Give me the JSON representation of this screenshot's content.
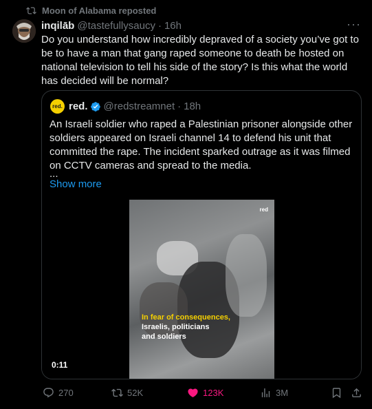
{
  "repost": {
    "text": "Moon of Alabama reposted"
  },
  "tweet": {
    "author_name": "inqilāb",
    "handle": "@tastefullysaucy",
    "separator": "·",
    "time": "16h",
    "more": "···",
    "text": "Do you understand how incredibly depraved of a society you’ve got to be to have a man that gang raped someone to death be hosted on national television to tell his side of the story? Is this what the world has decided will be normal?"
  },
  "quote": {
    "logo_text": "red.",
    "author_name": "red.",
    "handle": "@redstreamnet",
    "separator": "·",
    "time": "18h",
    "text": "An Israeli soldier who raped a Palestinian prisoner alongside other soldiers appeared on Israeli channel 14 to defend his unit that committed the rape. The incident sparked outrage as it was filmed on CCTV cameras and spread to the media.",
    "ellipsis": "...",
    "show_more": "Show more",
    "video": {
      "brand": "red",
      "caption_highlight": "In fear of consequences,",
      "caption_line2": "Israelis, politicians",
      "caption_line3": "and soldiers",
      "duration": "0:11"
    }
  },
  "actions": {
    "replies": "270",
    "reposts": "52K",
    "likes": "123K",
    "views": "3M"
  },
  "colors": {
    "background": "#000000",
    "text": "#e7e9ea",
    "muted": "#71767b",
    "link": "#1d9bf0",
    "like": "#f91880",
    "brand_yellow": "#f5d000"
  }
}
